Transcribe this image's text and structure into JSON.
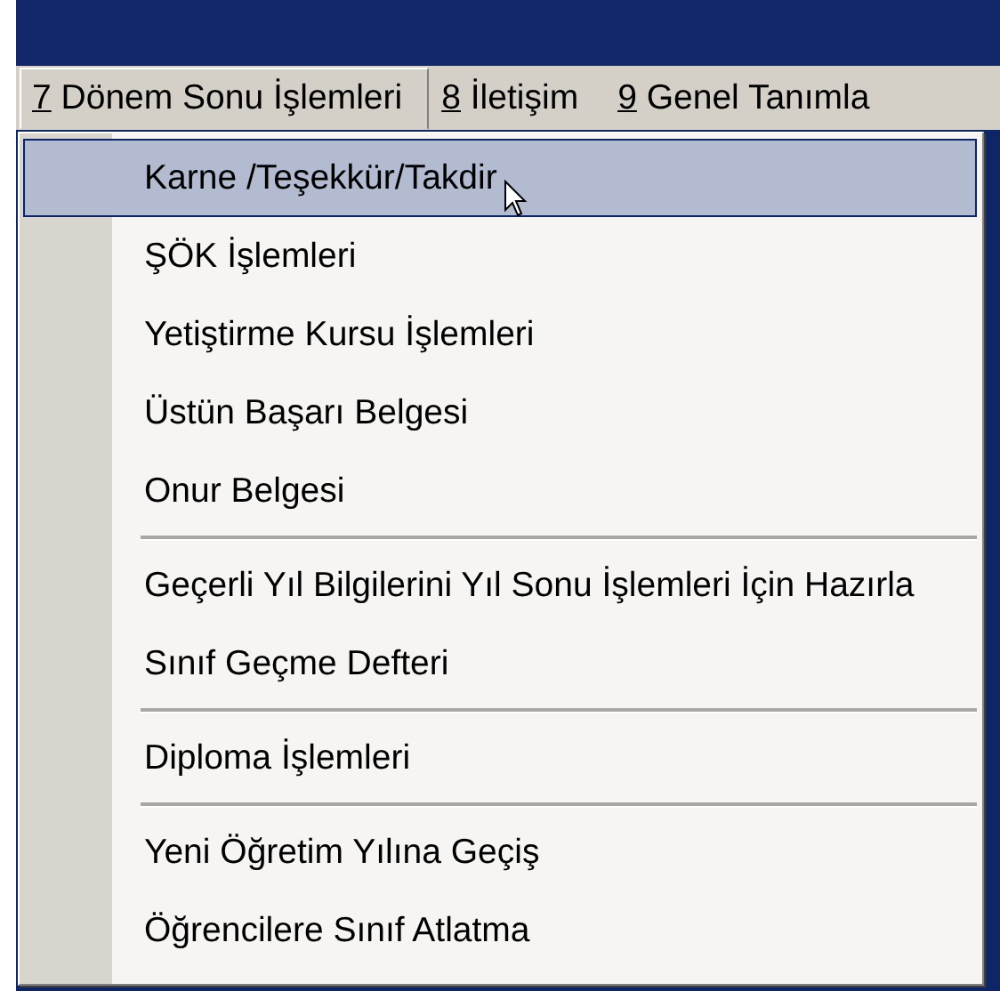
{
  "menu_bar": [
    {
      "key": "7",
      "label": "Dönem Sonu İşlemleri",
      "selected": true
    },
    {
      "key": "8",
      "label": "İletişim",
      "selected": false
    },
    {
      "key": "9",
      "label": "Genel Tanımla",
      "selected": false
    }
  ],
  "dropdown": {
    "groups": [
      {
        "items": [
          {
            "label": "Karne /Teşekkür/Takdir",
            "selected": true
          },
          {
            "label": "ŞÖK İşlemleri",
            "selected": false
          },
          {
            "label": "Yetiştirme Kursu İşlemleri",
            "selected": false
          },
          {
            "label": "Üstün Başarı Belgesi",
            "selected": false
          },
          {
            "label": "Onur Belgesi",
            "selected": false
          }
        ]
      },
      {
        "items": [
          {
            "label": "Geçerli Yıl Bilgilerini Yıl Sonu İşlemleri İçin Hazırla",
            "selected": false
          },
          {
            "label": "Sınıf Geçme Defteri",
            "selected": false
          }
        ]
      },
      {
        "items": [
          {
            "label": "Diploma İşlemleri",
            "selected": false
          }
        ]
      },
      {
        "items": [
          {
            "label": "Yeni Öğretim Yılına Geçiş",
            "selected": false
          },
          {
            "label": "Öğrencilere Sınıf Atlatma",
            "selected": false
          }
        ]
      }
    ]
  }
}
